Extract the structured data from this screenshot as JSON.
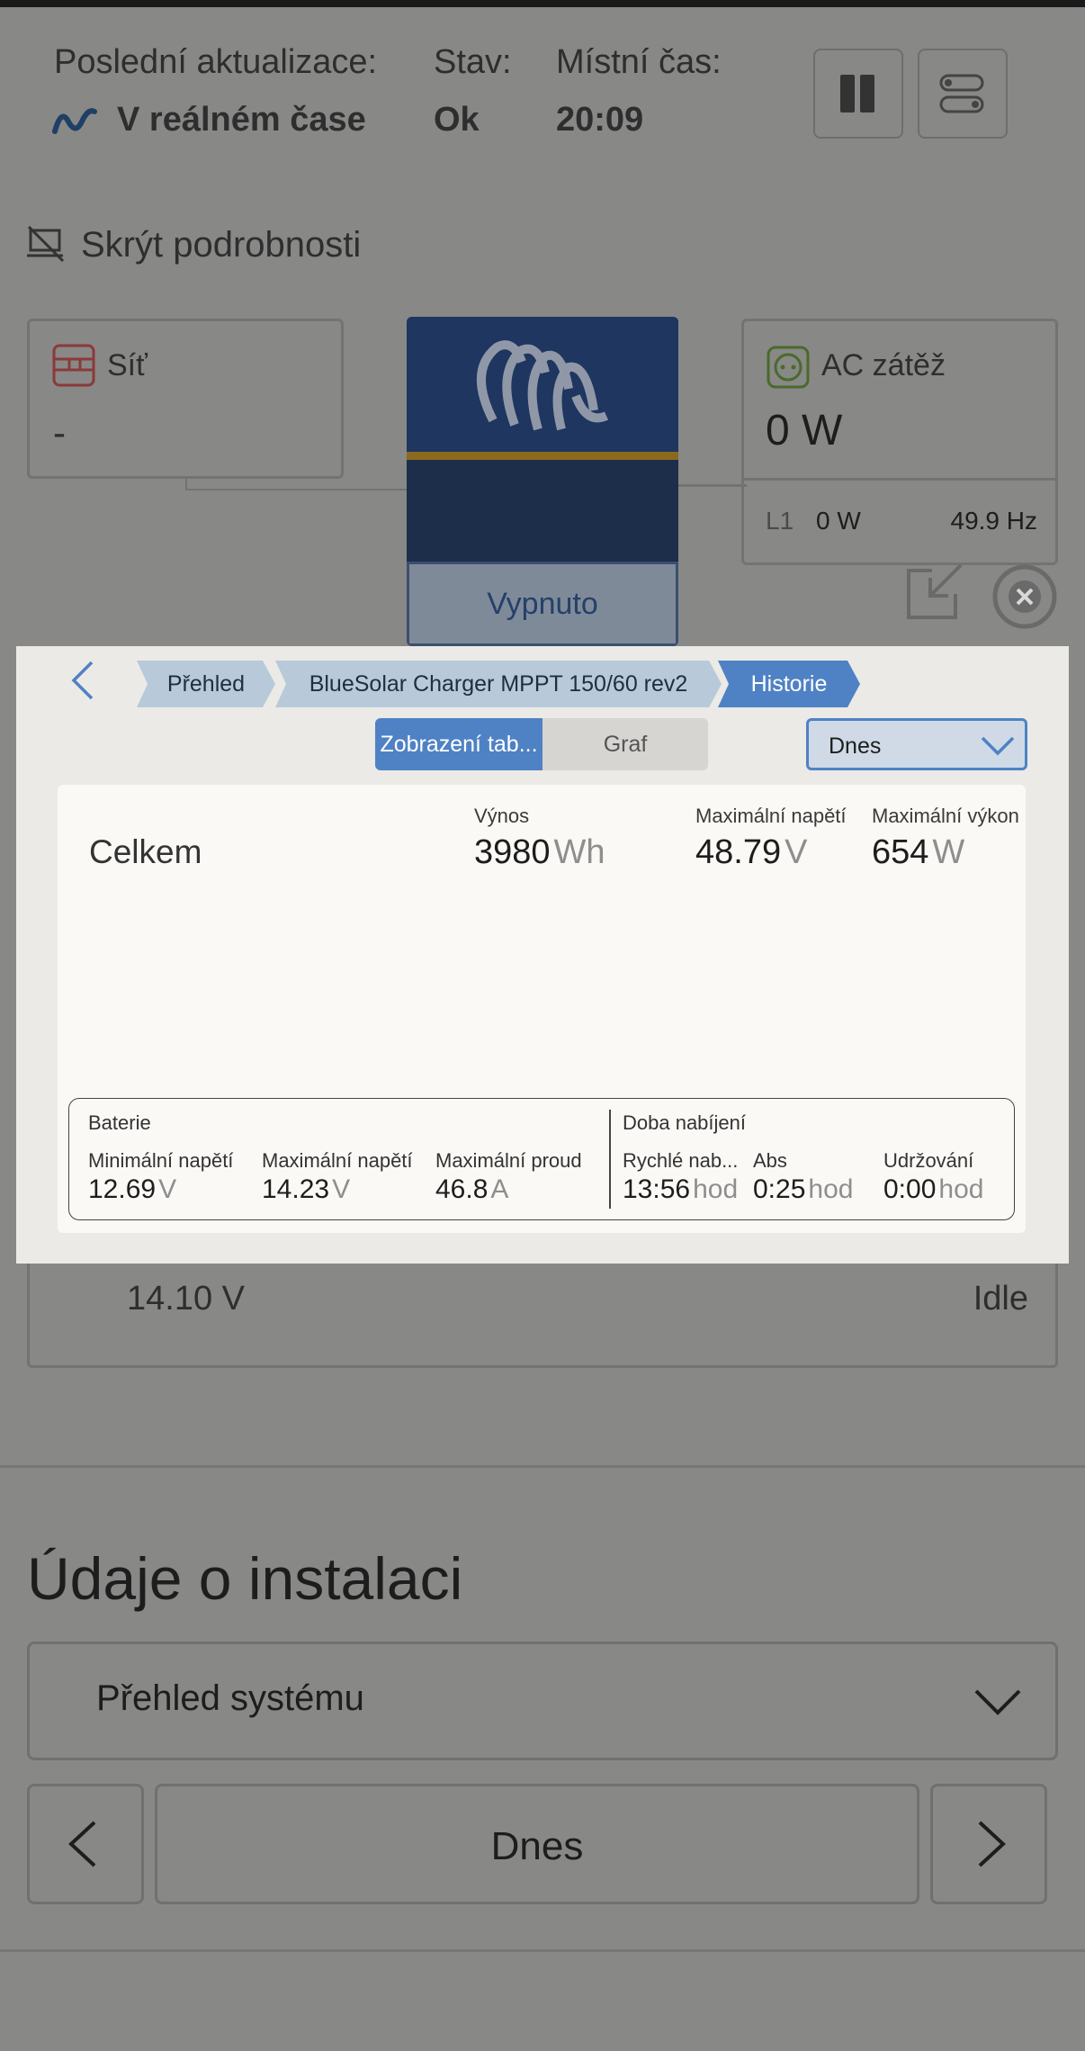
{
  "header": {
    "last_update_label": "Poslední aktualizace:",
    "last_update_value": "V reálném čase",
    "state_label": "Stav:",
    "state_value": "Ok",
    "local_time_label": "Místní čas:",
    "local_time_value": "20:09"
  },
  "hide_details": "Skrýt podrobnosti",
  "grid_card": {
    "title": "Síť",
    "value": "-"
  },
  "inverter_card": {
    "status": "Vypnuto"
  },
  "ac_load_card": {
    "title": "AC zátěž",
    "value": "0 W",
    "phase": "L1",
    "phase_power": "0 W",
    "frequency": "49.9 Hz"
  },
  "background_row": {
    "voltage": "14.10 V",
    "state": "Idle"
  },
  "modal": {
    "breadcrumbs": [
      "Přehled",
      "BlueSolar Charger MPPT 150/60 rev2",
      "Historie"
    ],
    "view_toggle": {
      "table": "Zobrazení tab...",
      "graph": "Graf"
    },
    "period_select": "Dnes",
    "summary": {
      "row_label": "Celkem",
      "yield_label": "Výnos",
      "yield_value": "3980",
      "yield_unit": "Wh",
      "max_voltage_label": "Maximální napětí",
      "max_voltage_value": "48.79",
      "max_voltage_unit": "V",
      "max_power_label": "Maximální výkon",
      "max_power_value": "654",
      "max_power_unit": "W"
    },
    "battery": {
      "title": "Baterie",
      "min_voltage_label": "Minimální napětí",
      "min_voltage_value": "12.69",
      "min_voltage_unit": "V",
      "max_voltage_label": "Maximální napětí",
      "max_voltage_value": "14.23",
      "max_voltage_unit": "V",
      "max_current_label": "Maximální proud",
      "max_current_value": "46.8",
      "max_current_unit": "A"
    },
    "charge_time": {
      "title": "Doba nabíjení",
      "bulk_label": "Rychlé nab...",
      "bulk_value": "13:56",
      "bulk_unit": "hod",
      "abs_label": "Abs",
      "abs_value": "0:25",
      "abs_unit": "hod",
      "float_label": "Udržování",
      "float_value": "0:00",
      "float_unit": "hod"
    }
  },
  "installation": {
    "title": "Údaje o instalaci",
    "select_value": "Přehled systému",
    "date_label": "Dnes"
  },
  "colors": {
    "accent": "#4f82c4",
    "overlay": "#888887",
    "modal_bg": "#ebeae6"
  }
}
